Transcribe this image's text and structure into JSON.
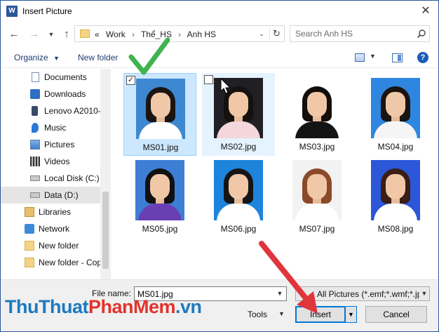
{
  "window": {
    "title": "Insert Picture",
    "app_icon_letter": "W"
  },
  "nav": {
    "breadcrumb": [
      "«",
      "Work",
      "Thể_HS",
      "Anh HS"
    ],
    "search_placeholder": "Search Anh HS"
  },
  "toolbar": {
    "organize_label": "Organize",
    "new_folder_label": "New folder"
  },
  "sidebar": {
    "items": [
      {
        "label": "Documents",
        "icon": "documents-icon"
      },
      {
        "label": "Downloads",
        "icon": "downloads-icon"
      },
      {
        "label": "Lenovo A2010-",
        "icon": "phone-icon"
      },
      {
        "label": "Music",
        "icon": "music-icon"
      },
      {
        "label": "Pictures",
        "icon": "pictures-icon"
      },
      {
        "label": "Videos",
        "icon": "videos-icon"
      },
      {
        "label": "Local Disk (C:)",
        "icon": "drive-icon"
      },
      {
        "label": "Data (D:)",
        "icon": "drive-icon",
        "selected": true
      },
      {
        "label": "Libraries",
        "icon": "libraries-icon"
      },
      {
        "label": "Network",
        "icon": "network-icon"
      },
      {
        "label": "New folder",
        "icon": "folder-icon"
      },
      {
        "label": "New folder - Cop",
        "icon": "folder-icon"
      }
    ]
  },
  "files": [
    {
      "name": "MS01.jpg",
      "selected": true,
      "checked": true,
      "bg": "#3e87d1",
      "shirt": "#ffffff",
      "hair": "#1a1412"
    },
    {
      "name": "MS02.jpg",
      "hover": true,
      "bg": "#1f1f24",
      "shirt": "#f4d7da",
      "hair": "#15110f"
    },
    {
      "name": "MS03.jpg",
      "bg": "#ffffff",
      "shirt": "#141414",
      "hair": "#120e0c"
    },
    {
      "name": "MS04.jpg",
      "bg": "#2f86e0",
      "shirt": "#f5f5f5",
      "hair": "#1a1410"
    },
    {
      "name": "MS05.jpg",
      "bg": "#3e7fd6",
      "shirt": "#6a3fb3",
      "hair": "#111111"
    },
    {
      "name": "MS06.jpg",
      "bg": "#1d84dc",
      "shirt": "#ffffff",
      "hair": "#151515"
    },
    {
      "name": "MS07.jpg",
      "bg": "#f2f2f2",
      "shirt": "#ffffff",
      "hair": "#8a4a2a"
    },
    {
      "name": "MS08.jpg",
      "bg": "#2c57d8",
      "shirt": "#ffffff",
      "hair": "#3a1e14"
    }
  ],
  "footer": {
    "file_name_label": "File name:",
    "file_name_value": "MS01.jpg",
    "file_type_value": "All Pictures (*.emf;*.wmf;*.jpg;*",
    "tools_label": "Tools",
    "insert_label": "Insert",
    "cancel_label": "Cancel"
  },
  "watermark": {
    "part1": "ThuThuat",
    "part2": "PhanMem",
    "part3": ".vn"
  },
  "colors": {
    "accent": "#0078d7",
    "selection": "#cce8ff",
    "annotation_arrow": "#e0353b",
    "annotation_check": "#3fb34f"
  }
}
